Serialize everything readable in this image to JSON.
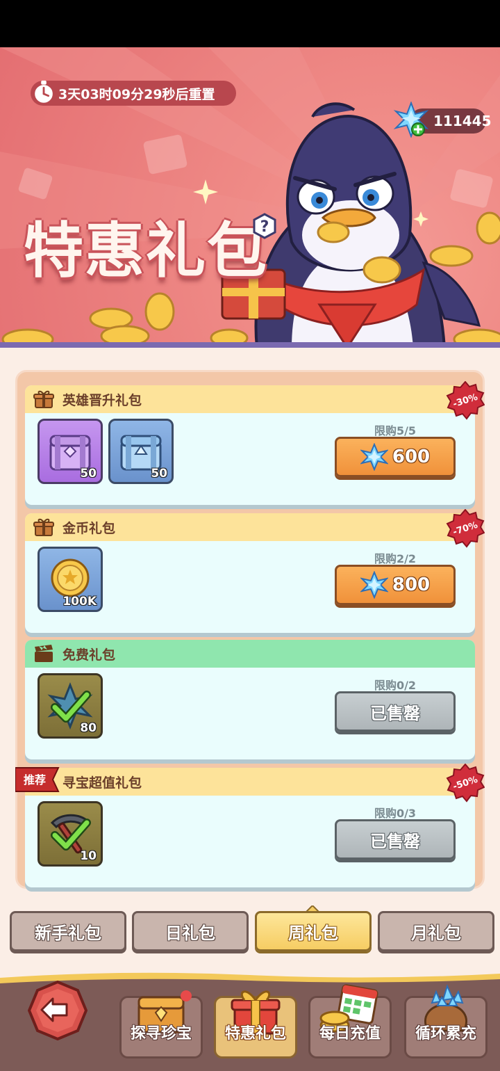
{
  "banner": {
    "timer": "3天03时09分29秒后重置",
    "gems": "111445",
    "title": "特惠礼包"
  },
  "packs": [
    {
      "title": "英雄晋升礼包",
      "discount": "-30%",
      "items": [
        {
          "icon": "purple-chest-icon",
          "count": "50"
        },
        {
          "icon": "blue-chest-icon",
          "count": "50"
        }
      ],
      "limit": "限购5/5",
      "button": "600"
    },
    {
      "title": "金币礼包",
      "discount": "-70%",
      "items": [
        {
          "icon": "gold-coin-icon",
          "count": "100K"
        }
      ],
      "limit": "限购2/2",
      "button": "800"
    },
    {
      "title": "免费礼包",
      "items": [
        {
          "icon": "crystal-claimed-icon",
          "count": "80"
        }
      ],
      "limit": "限购0/2",
      "button": "已售罄"
    },
    {
      "title": "寻宝超值礼包",
      "badge": "推荐",
      "discount": "-50%",
      "items": [
        {
          "icon": "pickaxe-claimed-icon",
          "count": "10"
        }
      ],
      "limit": "限购0/3",
      "button": "已售罄"
    }
  ],
  "tabs": [
    "新手礼包",
    "日礼包",
    "周礼包",
    "月礼包"
  ],
  "active_tab": "周礼包",
  "bottom_nav": [
    "探寻珍宝",
    "特惠礼包",
    "每日充值",
    "循环累充"
  ],
  "colors": {
    "banner": "#e97b7b",
    "card_header": "#fde39a",
    "free_header": "#8fe6ae",
    "buy_button": "#f0913a",
    "sold_button": "#aeb5b8"
  }
}
